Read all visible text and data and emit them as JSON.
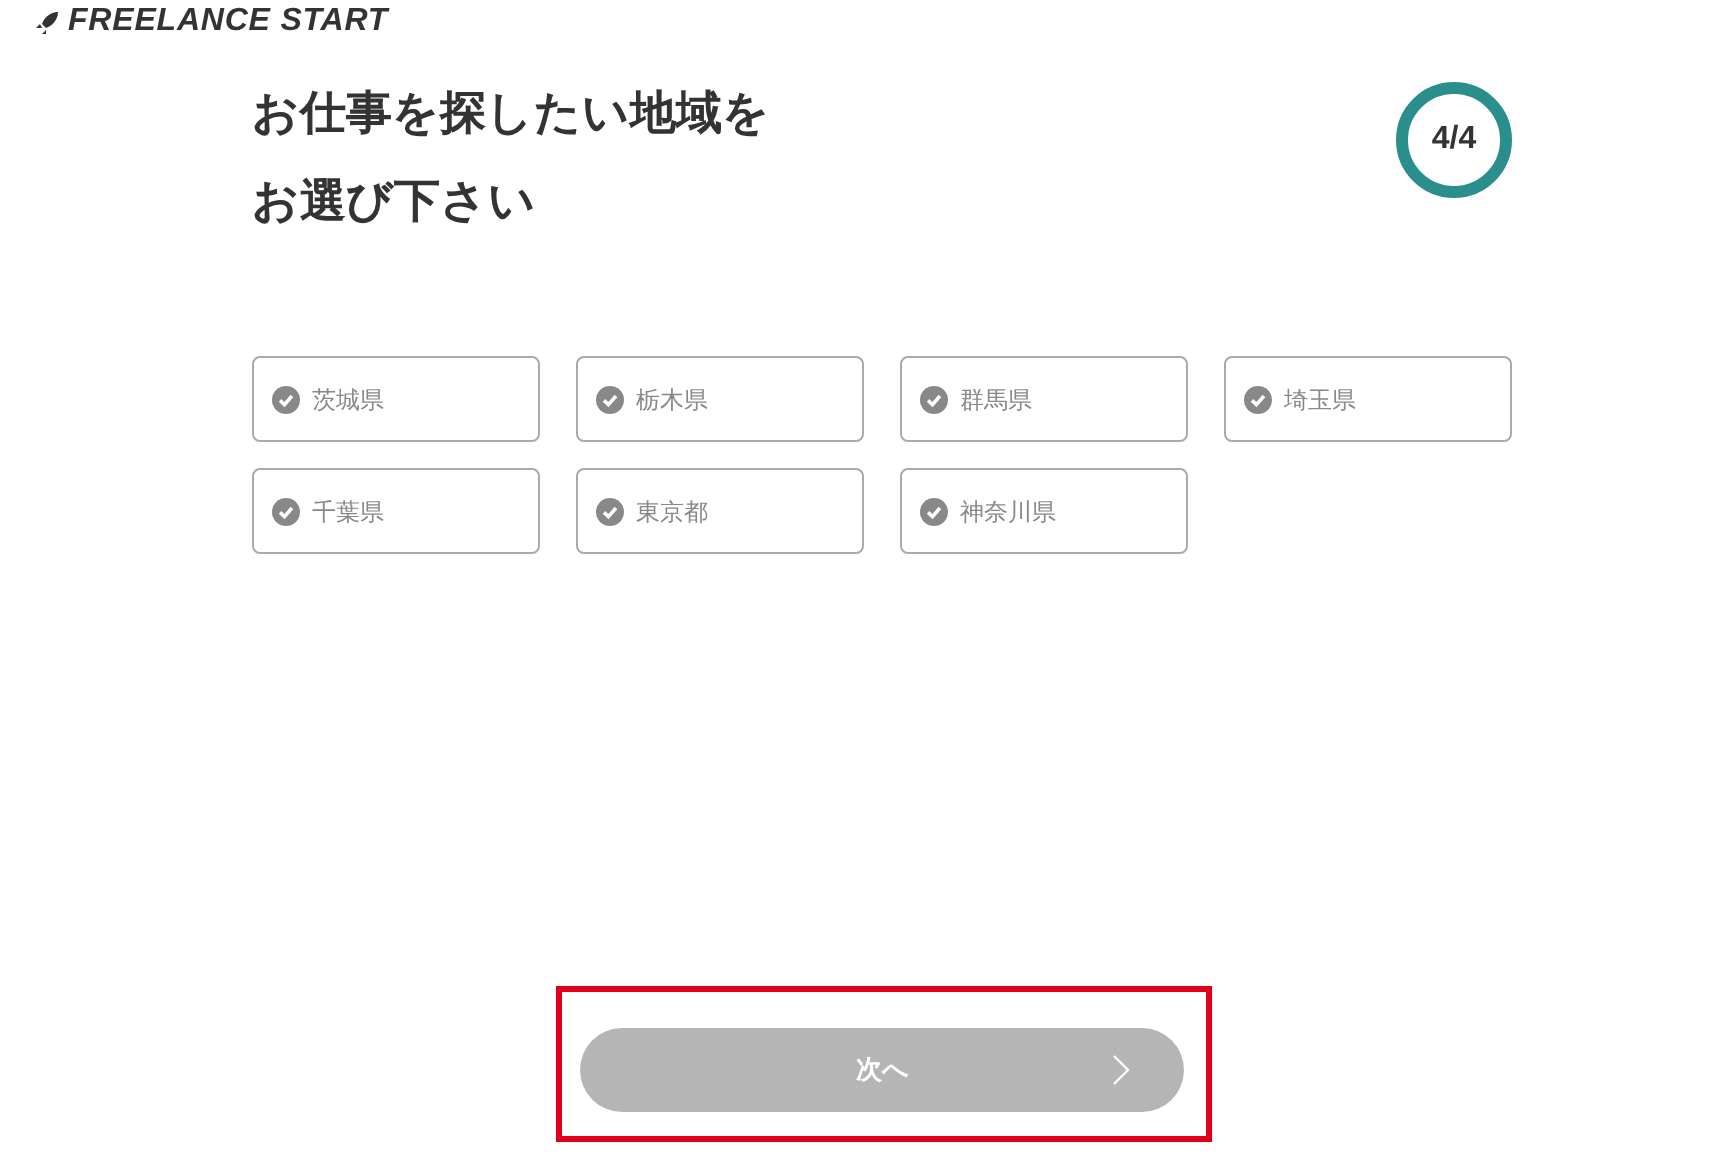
{
  "logo": {
    "text": "FREELANCE START"
  },
  "heading": [
    "お仕事を探したい地域を",
    "お選び下さい"
  ],
  "step": {
    "text": "4/4"
  },
  "options": [
    {
      "label": "茨城県",
      "selected": false
    },
    {
      "label": "栃木県",
      "selected": false
    },
    {
      "label": "群馬県",
      "selected": false
    },
    {
      "label": "埼玉県",
      "selected": false
    },
    {
      "label": "千葉県",
      "selected": false
    },
    {
      "label": "東京都",
      "selected": false
    },
    {
      "label": "神奈川県",
      "selected": false
    }
  ],
  "next_button": {
    "label": "次へ",
    "disabled": true
  }
}
